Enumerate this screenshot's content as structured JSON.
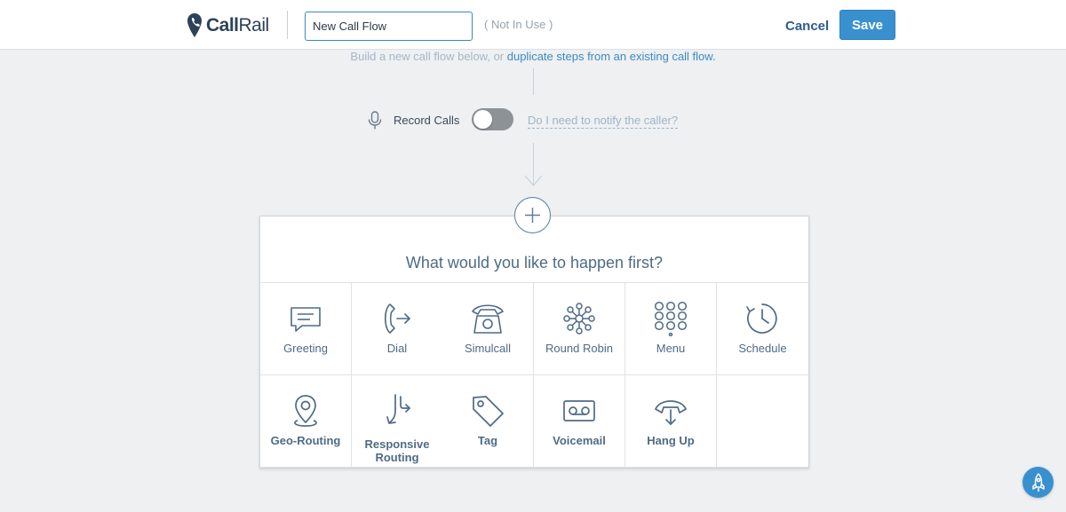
{
  "header": {
    "logo_text_bold": "Call",
    "logo_text_light": "Rail",
    "flow_name_value": "New Call Flow",
    "status": "( Not In Use )",
    "cancel_label": "Cancel",
    "save_label": "Save"
  },
  "intro": {
    "text": "Build a new call flow below, or ",
    "link": "duplicate steps from an existing call flow."
  },
  "record": {
    "label": "Record Calls",
    "enabled": false,
    "notify_link": "Do I need to notify the caller?"
  },
  "panel": {
    "title": "What would you like to happen first?",
    "tiles": [
      {
        "label": "Greeting",
        "icon": "speech-bubble-icon"
      },
      {
        "label": "Dial",
        "icon": "phone-forward-icon"
      },
      {
        "label": "Simulcall",
        "icon": "desk-phone-icon"
      },
      {
        "label": "Round Robin",
        "icon": "round-robin-icon"
      },
      {
        "label": "Menu",
        "icon": "keypad-icon"
      },
      {
        "label": "Schedule",
        "icon": "clock-icon"
      },
      {
        "label": "Geo-Routing",
        "icon": "map-pin-icon"
      },
      {
        "label": "Responsive Routing",
        "icon": "split-arrow-icon"
      },
      {
        "label": "Tag",
        "icon": "tag-icon"
      },
      {
        "label": "Voicemail",
        "icon": "voicemail-icon"
      },
      {
        "label": "Hang Up",
        "icon": "hang-up-icon"
      }
    ]
  },
  "colors": {
    "accent": "#3990cf",
    "icon_stroke": "#4e6b86",
    "background": "#eef0f2"
  },
  "help_button_icon": "rocket-icon"
}
